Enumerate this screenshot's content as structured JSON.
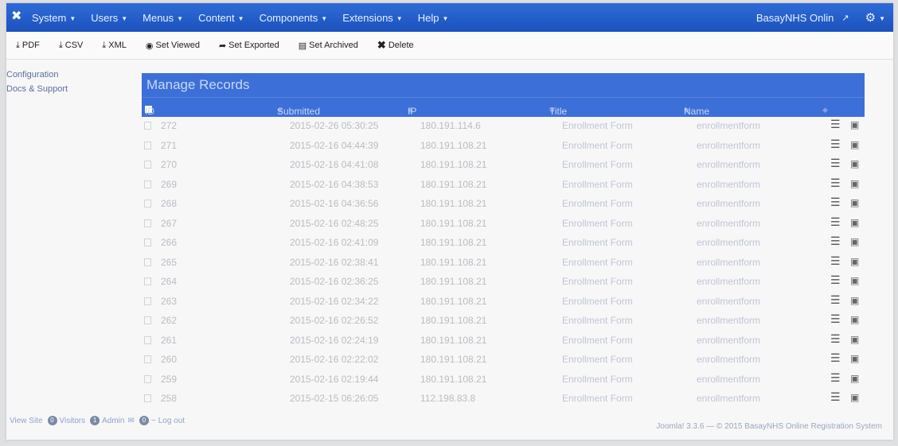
{
  "navbar": {
    "menus": [
      "System",
      "Users",
      "Menus",
      "Content",
      "Components",
      "Extensions",
      "Help"
    ],
    "site_name": "BasayNHS Onlin",
    "logo_icon": "joomla-logo-icon",
    "gear_icon": "gear-icon",
    "external_icon": "external-link-icon",
    "accent_color": "#1b52bd"
  },
  "toolbar": {
    "pdf": "PDF",
    "csv": "CSV",
    "xml": "XML",
    "set_viewed": "Set Viewed",
    "set_exported": "Set Exported",
    "set_archived": "Set Archived",
    "delete": "Delete"
  },
  "sidebar": {
    "items": [
      "Configuration",
      "Docs & Support"
    ]
  },
  "main": {
    "title": "Manage Records",
    "columns": {
      "id": "ID",
      "submitted": "Submitted",
      "ip": "IP",
      "title": "Title",
      "name": "Name"
    },
    "rows": [
      {
        "id": "272",
        "submitted": "2015-02-26 05:30:25",
        "ip": "180.191.114.6",
        "title": "Enrollment Form",
        "name": "enrollmentform"
      },
      {
        "id": "271",
        "submitted": "2015-02-16 04:44:39",
        "ip": "180.191.108.21",
        "title": "Enrollment Form",
        "name": "enrollmentform"
      },
      {
        "id": "270",
        "submitted": "2015-02-16 04:41:08",
        "ip": "180.191.108.21",
        "title": "Enrollment Form",
        "name": "enrollmentform"
      },
      {
        "id": "269",
        "submitted": "2015-02-16 04:38:53",
        "ip": "180.191.108.21",
        "title": "Enrollment Form",
        "name": "enrollmentform"
      },
      {
        "id": "268",
        "submitted": "2015-02-16 04:36:56",
        "ip": "180.191.108.21",
        "title": "Enrollment Form",
        "name": "enrollmentform"
      },
      {
        "id": "267",
        "submitted": "2015-02-16 02:48:25",
        "ip": "180.191.108.21",
        "title": "Enrollment Form",
        "name": "enrollmentform"
      },
      {
        "id": "266",
        "submitted": "2015-02-16 02:41:09",
        "ip": "180.191.108.21",
        "title": "Enrollment Form",
        "name": "enrollmentform"
      },
      {
        "id": "265",
        "submitted": "2015-02-16 02:38:41",
        "ip": "180.191.108.21",
        "title": "Enrollment Form",
        "name": "enrollmentform"
      },
      {
        "id": "264",
        "submitted": "2015-02-16 02:36:25",
        "ip": "180.191.108.21",
        "title": "Enrollment Form",
        "name": "enrollmentform"
      },
      {
        "id": "263",
        "submitted": "2015-02-16 02:34:22",
        "ip": "180.191.108.21",
        "title": "Enrollment Form",
        "name": "enrollmentform"
      },
      {
        "id": "262",
        "submitted": "2015-02-16 02:26:52",
        "ip": "180.191.108.21",
        "title": "Enrollment Form",
        "name": "enrollmentform"
      },
      {
        "id": "261",
        "submitted": "2015-02-16 02:24:19",
        "ip": "180.191.108.21",
        "title": "Enrollment Form",
        "name": "enrollmentform"
      },
      {
        "id": "260",
        "submitted": "2015-02-16 02:22:02",
        "ip": "180.191.108.21",
        "title": "Enrollment Form",
        "name": "enrollmentform"
      },
      {
        "id": "259",
        "submitted": "2015-02-16 02:19:44",
        "ip": "180.191.108.21",
        "title": "Enrollment Form",
        "name": "enrollmentform"
      },
      {
        "id": "258",
        "submitted": "2015-02-15 06:26:05",
        "ip": "112.198.83.8",
        "title": "Enrollment Form",
        "name": "enrollmentform"
      }
    ]
  },
  "footer": {
    "view_site": "View Site",
    "visitors_count": "0",
    "visitors_label": "Visitors",
    "admin_count": "1",
    "admin_label": "Admin",
    "messages_count": "0",
    "logout_label": "Log out",
    "credit": "Joomla! 3.3.6 — © 2015 BasayNHS Online Registration System"
  }
}
